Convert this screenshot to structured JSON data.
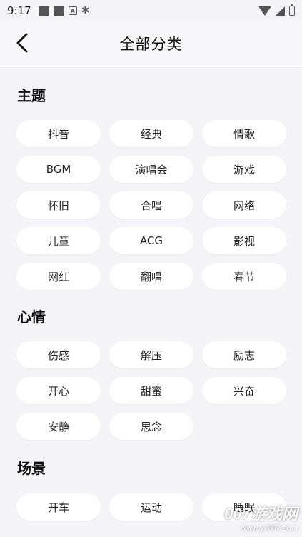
{
  "status_bar": {
    "time": "9:17"
  },
  "header": {
    "title": "全部分类",
    "back_icon": "chevron-left-icon"
  },
  "sections": [
    {
      "title": "主题",
      "items": [
        "抖音",
        "经典",
        "情歌",
        "BGM",
        "演唱会",
        "游戏",
        "怀旧",
        "合唱",
        "网络",
        "儿童",
        "ACG",
        "影视",
        "网红",
        "翻唱",
        "春节"
      ]
    },
    {
      "title": "心情",
      "items": [
        "伤感",
        "解压",
        "励志",
        "开心",
        "甜蜜",
        "兴奋",
        "安静",
        "思念"
      ]
    },
    {
      "title": "场景",
      "items": [
        "开车",
        "运动",
        "睡眠"
      ]
    }
  ],
  "watermark": {
    "main": "007游戏网",
    "url": "www.yx007.com"
  }
}
